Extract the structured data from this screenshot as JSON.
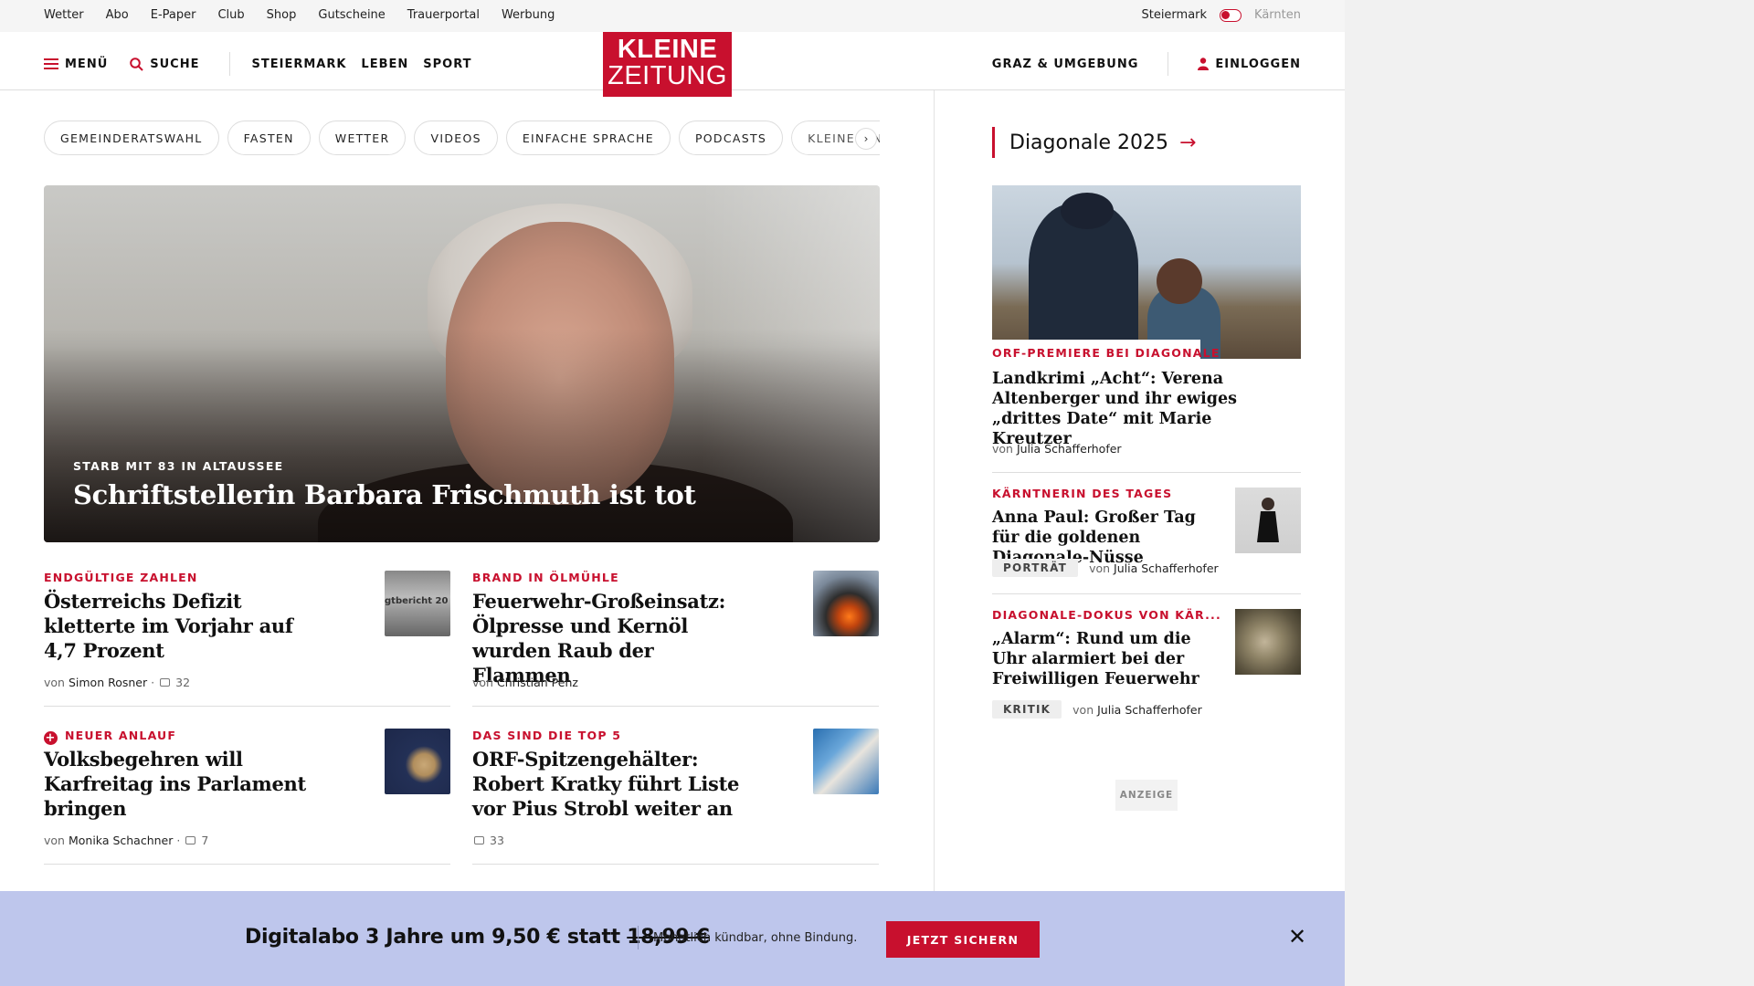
{
  "topbar": {
    "links": [
      "Wetter",
      "Abo",
      "E-Paper",
      "Club",
      "Shop",
      "Gutscheine",
      "Trauerportal",
      "Werbung"
    ],
    "region_active": "Steiermark",
    "region_inactive": "Kärnten"
  },
  "header": {
    "menu_label": "MENÜ",
    "search_label": "SUCHE",
    "sections": [
      "STEIERMARK",
      "LEBEN",
      "SPORT"
    ],
    "logo_line1": "KLEINE",
    "logo_line2": "ZEITUNG",
    "location": "GRAZ & UMGEBUNG",
    "login_label": "EINLOGGEN"
  },
  "topics": [
    "GEMEINDERATSWAHL",
    "FASTEN",
    "WETTER",
    "VIDEOS",
    "EINFACHE SPRACHE",
    "PODCASTS",
    "KLEINE KINDE"
  ],
  "hero": {
    "kicker": "STARB MIT 83 IN ALTAUSSEE",
    "title": "Schriftstellerin Barbara Frischmuth ist tot"
  },
  "articles": [
    {
      "kicker": "ENDGÜLTIGE ZAHLEN",
      "title": "Österreichs Defizit kletterte im Vorjahr auf 4,7 Prozent",
      "author": "Simon Rosner",
      "comments": "32",
      "thumb_text": "gtbericht 20"
    },
    {
      "kicker": "BRAND IN ÖLMÜHLE",
      "title": "Feuerwehr-Großeinsatz: Ölpresse und Kernöl wurden Raub der Flammen",
      "author": "Christian Penz",
      "comments": ""
    },
    {
      "kicker": "NEUER ANLAUF",
      "title": "Volksbegehren will Karfreitag ins Parlament bringen",
      "author": "Monika Schachner",
      "comments": "7"
    },
    {
      "kicker": "DAS SIND DIE TOP 5",
      "title": "ORF-Spitzengehälter: Robert Kratky führt Liste vor Pius Strobl weiter an",
      "author": "",
      "comments": "33"
    }
  ],
  "sidebar": {
    "heading": "Diagonale 2025",
    "feature": {
      "kicker": "ORF-PREMIERE BEI DIAGONALE",
      "title": "Landkrimi „Acht“: Verena Altenberger und ihr ewiges „drittes Date“ mit Marie Kreutzer",
      "author": "Julia Schafferhofer"
    },
    "items": [
      {
        "kicker": "KÄRNTNERIN DES TAGES",
        "title": "Anna Paul: Großer Tag für die goldenen Diagonale-Nüsse",
        "tag": "PORTRÄT",
        "author": "Julia Schafferhofer"
      },
      {
        "kicker": "DIAGONALE-DOKUS VON KÄR...",
        "title": "„Alarm“: Rund um die Uhr alarmiert bei der Freiwilligen Feuerwehr",
        "tag": "KRITIK",
        "author": "Julia Schafferhofer"
      }
    ],
    "by_prefix": "von",
    "ad_label": "ANZEIGE"
  },
  "promo": {
    "text_main": "Digitalabo 3 Jahre um 9,50 € statt",
    "old_price": "18,99 €",
    "note": "Monatlich kündbar, ohne Bindung.",
    "button": "JETZT SICHERN"
  },
  "colors": {
    "brand_red": "#c8102e",
    "promo_bg": "#bec6ec"
  }
}
